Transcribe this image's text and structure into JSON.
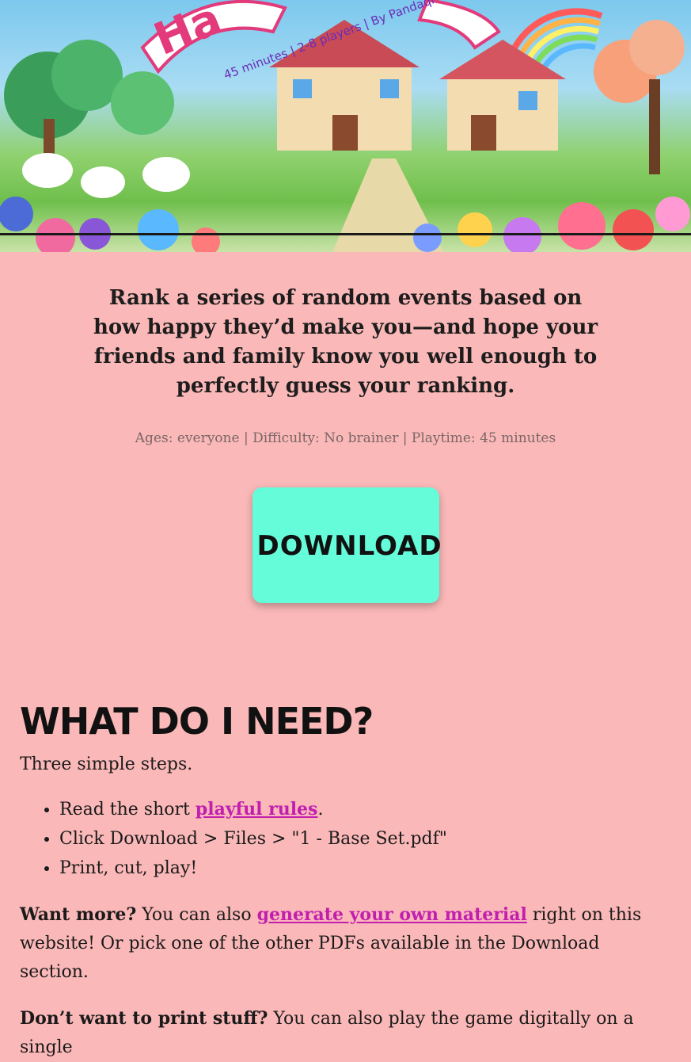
{
  "hero": {
    "title_partial": "Ha",
    "subtitle": "45 minutes | 2-8 players | By Pandaqi"
  },
  "tagline": "Rank a series of random events based on how happy they’d make you—and hope your friends and family know you well enough to perfectly guess your ranking.",
  "meta": "Ages: everyone | Difficulty: No brainer | Playtime: 45 minutes",
  "download": {
    "label": "Download"
  },
  "need": {
    "heading": "What do I need?",
    "intro": "Three simple steps.",
    "steps": {
      "s1_before": "Read the short ",
      "s1_link": "playful rules",
      "s1_after": ".",
      "s2": "Click Download > Files > \"1 - Base Set.pdf\"",
      "s3": "Print, cut, play!"
    },
    "more": {
      "bold": "Want more?",
      "before": " You can also ",
      "link": "generate your own material",
      "after": " right on this website! Or pick one of the other PDFs available in the Download section."
    },
    "noprint": {
      "bold": "Don’t want to print stuff?",
      "text": " You can also play the game digitally on a single"
    }
  }
}
